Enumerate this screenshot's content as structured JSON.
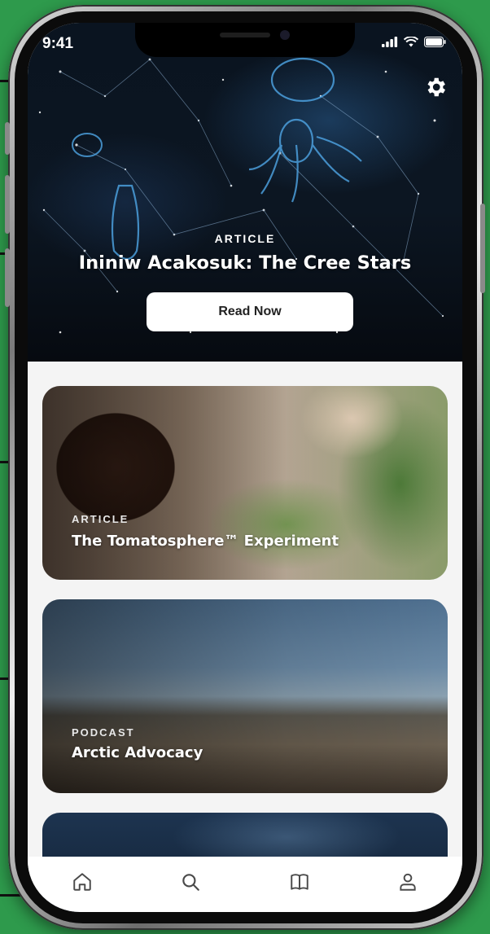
{
  "status_bar": {
    "time": "9:41",
    "icons": [
      "signal-icon",
      "wifi-icon",
      "battery-icon"
    ]
  },
  "header": {
    "settings_icon": "gear-icon"
  },
  "hero": {
    "kind": "ARTICLE",
    "title": "Ininiw Acakosuk: The Cree Stars",
    "button_label": "Read Now"
  },
  "cards": [
    {
      "kind": "ARTICLE",
      "title": "The Tomatosphere™ Experiment"
    },
    {
      "kind": "PODCAST",
      "title": "Arctic Advocacy"
    }
  ],
  "tab_bar": {
    "items": [
      {
        "icon": "home-icon"
      },
      {
        "icon": "search-icon"
      },
      {
        "icon": "book-icon"
      },
      {
        "icon": "profile-icon"
      }
    ]
  },
  "colors": {
    "background": "#2e9a4c",
    "card_text": "#ffffff",
    "tab_icon": "#4a4a4a"
  }
}
